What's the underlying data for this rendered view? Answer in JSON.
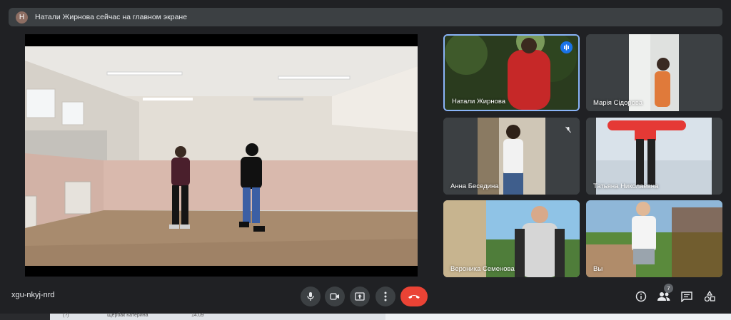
{
  "notice": {
    "avatar_letter": "Н",
    "text": "Натали Жирнова сейчас на главном экране"
  },
  "tiles": [
    {
      "name": "Натали Жирнова"
    },
    {
      "name": "Марія Сідорова"
    },
    {
      "name": "Анна Беседина"
    },
    {
      "name": "Татьяна Николаевна"
    },
    {
      "name": "Вероника Семенова"
    },
    {
      "name": "Вы"
    }
  ],
  "meeting_code": "xgu-nkyj-nrd",
  "participants_count": "7",
  "taskbar": {
    "item1": "Щербак Катерина",
    "item2": "14.09",
    "item3": "(?)"
  },
  "colors": {
    "end_call": "#ea4335",
    "active_border": "#8ab4f8",
    "bg": "#202124"
  },
  "icons": [
    "mic-icon",
    "camera-icon",
    "present-icon",
    "more-icon",
    "end-call-icon",
    "info-icon",
    "people-icon",
    "chat-icon",
    "activities-icon"
  ]
}
